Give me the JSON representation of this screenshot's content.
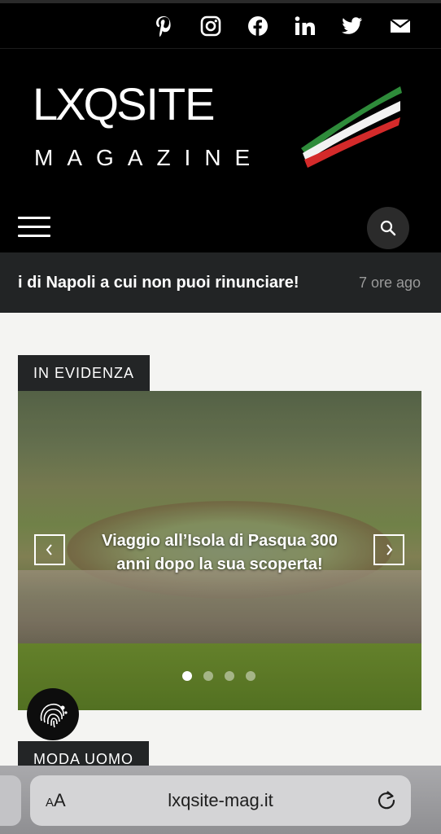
{
  "social": {
    "icons": [
      "pinterest-icon",
      "instagram-icon",
      "facebook-icon",
      "linkedin-icon",
      "twitter-icon",
      "email-icon"
    ]
  },
  "logo": {
    "main_text": "LXQ",
    "site_text": "SITE",
    "sub_text": "MAGAZINE",
    "flag_colors": [
      "#2e8b3a",
      "#f2f2f2",
      "#d42a2a"
    ]
  },
  "nav": {
    "menu_icon": "hamburger-icon",
    "search_icon": "search-icon"
  },
  "ticker": {
    "headline": "i di Napoli a cui non puoi rinunciare!",
    "time": "7 ore ago"
  },
  "featured": {
    "badge": "IN EVIDENZA",
    "slide_title": "Viaggio all’Isola di Pasqua 300 anni dopo la sua scoperta!",
    "slide_count": 4,
    "active_slide": 1,
    "prev_icon": "chevron-left-icon",
    "next_icon": "chevron-right-icon"
  },
  "section2": {
    "badge": "MODA UOMO"
  },
  "browser": {
    "aa_small": "A",
    "aa_large": "A",
    "url": "lxqsite-mag.it",
    "reload_icon": "reload-icon"
  },
  "colors": {
    "dark_bg": "#000000",
    "ticker_bg": "#222425",
    "badge_bg": "#232526",
    "page_bg": "#f4f4f2"
  }
}
